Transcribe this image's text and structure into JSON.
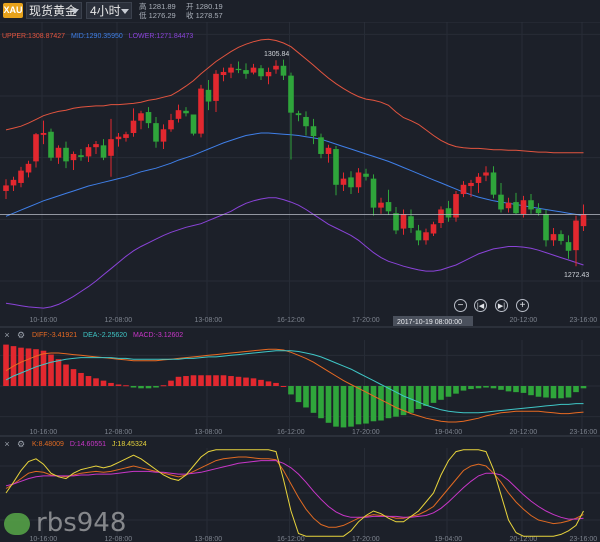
{
  "toolbar": {
    "badge": "XAU",
    "symbol": "现货黄金",
    "period": "4小时",
    "high_label": "高",
    "high": "1281.89",
    "low_label": "低",
    "low": "1276.29",
    "open_label": "开",
    "open": "1280.19",
    "close_label": "收",
    "close": "1278.57"
  },
  "legends": {
    "boll": {
      "upper": "UPPER:1308.87427",
      "mid": "MID:1290.35950",
      "lower": "LOWER:1271.84473"
    },
    "macd": {
      "diff": "DIFF:-3.41921",
      "dea": "DEA:-2.25620",
      "macd": "MACD:-3.12602"
    },
    "kdj": {
      "k": "K:8.48009",
      "d": "D:14.60551",
      "j": "J:18.45324"
    }
  },
  "controls": {
    "close_icon": "×",
    "settings_icon": "gear-icon"
  },
  "watermark": "rbs948",
  "colors": {
    "up": "#e2282f",
    "down": "#2fa53b",
    "upper": "#e2543f",
    "mid": "#3f7fe8",
    "lower": "#8a43d8",
    "diff": "#e86a22",
    "dea": "#3fc6c6",
    "k": "#e06a22",
    "d": "#c836c8",
    "j": "#e8d43c"
  },
  "chart_data": [
    {
      "type": "candlestick",
      "name": "main",
      "x_ticks": [
        "10-16:00",
        "12-08:00",
        "13-08:00",
        "16-12:00",
        "17-20:00",
        "19-04:00",
        "20-12:00",
        "23-16:00"
      ],
      "crosshair_label": "2017-10-19 08:00:00",
      "ylim": [
        1264,
        1312
      ],
      "annotations": [
        {
          "text": "1305.84",
          "index": 36,
          "value": 1305.84
        },
        {
          "text": "1272.43",
          "index": 76,
          "value": 1272.43
        }
      ],
      "candles": [
        [
          1284.6,
          1286.5,
          1283.3,
          1285.5
        ],
        [
          1285.5,
          1286.9,
          1284.6,
          1286.4
        ],
        [
          1285.9,
          1288.5,
          1285.2,
          1287.9
        ],
        [
          1287.6,
          1289.5,
          1286.8,
          1289.0
        ],
        [
          1289.4,
          1294.0,
          1288.4,
          1293.8
        ],
        [
          1293.7,
          1296.0,
          1292.2,
          1294.0
        ],
        [
          1294.2,
          1294.7,
          1289.5,
          1290.0
        ],
        [
          1290.0,
          1292.0,
          1289.0,
          1291.6
        ],
        [
          1291.6,
          1292.6,
          1288.3,
          1289.4
        ],
        [
          1289.6,
          1291.0,
          1288.0,
          1290.6
        ],
        [
          1290.4,
          1291.4,
          1289.5,
          1290.1
        ],
        [
          1290.2,
          1292.2,
          1289.3,
          1291.7
        ],
        [
          1291.7,
          1292.7,
          1290.6,
          1292.2
        ],
        [
          1292.0,
          1293.0,
          1289.6,
          1290.0
        ],
        [
          1290.3,
          1296.3,
          1286.9,
          1293.0
        ],
        [
          1293.0,
          1294.0,
          1291.8,
          1293.4
        ],
        [
          1293.2,
          1294.2,
          1292.6,
          1293.8
        ],
        [
          1294.0,
          1298.0,
          1293.4,
          1296.0
        ],
        [
          1296.0,
          1297.6,
          1294.6,
          1297.2
        ],
        [
          1297.4,
          1298.2,
          1294.8,
          1295.6
        ],
        [
          1295.6,
          1296.6,
          1291.6,
          1292.6
        ],
        [
          1292.6,
          1295.4,
          1291.4,
          1294.6
        ],
        [
          1294.6,
          1297.1,
          1294.2,
          1296.1
        ],
        [
          1296.3,
          1298.6,
          1295.7,
          1297.7
        ],
        [
          1297.6,
          1298.2,
          1296.7,
          1297.2
        ],
        [
          1297.0,
          1294.9,
          1293.6,
          1293.9
        ],
        [
          1293.9,
          1301.8,
          1293.3,
          1301.2
        ],
        [
          1301.0,
          1302.6,
          1297.7,
          1299.1
        ],
        [
          1299.2,
          1304.2,
          1297.4,
          1303.6
        ],
        [
          1303.4,
          1304.6,
          1302.4,
          1303.9
        ],
        [
          1303.8,
          1305.2,
          1302.9,
          1304.6
        ],
        [
          1304.4,
          1305.6,
          1303.7,
          1304.2
        ],
        [
          1304.2,
          1305.3,
          1302.8,
          1303.6
        ],
        [
          1303.8,
          1305.2,
          1303.5,
          1304.6
        ],
        [
          1304.5,
          1305.0,
          1302.6,
          1303.2
        ],
        [
          1303.2,
          1304.6,
          1301.9,
          1303.9
        ],
        [
          1304.3,
          1305.8,
          1303.6,
          1304.9
        ],
        [
          1304.9,
          1305.9,
          1302.6,
          1303.3
        ],
        [
          1303.3,
          1303.8,
          1289.7,
          1297.3
        ],
        [
          1297.2,
          1297.6,
          1295.9,
          1296.9
        ],
        [
          1296.6,
          1297.5,
          1293.6,
          1295.1
        ],
        [
          1295.1,
          1296.3,
          1292.2,
          1293.5
        ],
        [
          1293.3,
          1293.9,
          1289.9,
          1290.6
        ],
        [
          1290.6,
          1292.1,
          1289.2,
          1291.6
        ],
        [
          1291.4,
          1291.9,
          1283.9,
          1285.6
        ],
        [
          1285.6,
          1287.6,
          1284.6,
          1286.6
        ],
        [
          1286.8,
          1287.8,
          1284.1,
          1285.2
        ],
        [
          1285.2,
          1288.3,
          1284.3,
          1287.6
        ],
        [
          1287.4,
          1288.2,
          1286.3,
          1286.9
        ],
        [
          1286.6,
          1287.3,
          1280.6,
          1281.9
        ],
        [
          1281.9,
          1283.5,
          1280.9,
          1282.7
        ],
        [
          1282.8,
          1284.8,
          1280.7,
          1281.3
        ],
        [
          1281.0,
          1282.0,
          1277.6,
          1278.2
        ],
        [
          1278.5,
          1281.6,
          1277.5,
          1280.8
        ],
        [
          1280.5,
          1281.6,
          1277.8,
          1278.6
        ],
        [
          1278.2,
          1279.1,
          1275.8,
          1276.6
        ],
        [
          1276.6,
          1278.5,
          1275.9,
          1277.9
        ],
        [
          1277.7,
          1279.6,
          1277.3,
          1279.2
        ],
        [
          1279.4,
          1282.1,
          1278.6,
          1281.6
        ],
        [
          1281.8,
          1283.0,
          1279.6,
          1280.3
        ],
        [
          1280.3,
          1284.6,
          1279.6,
          1284.1
        ],
        [
          1284.1,
          1286.2,
          1283.6,
          1285.6
        ],
        [
          1285.4,
          1286.4,
          1283.6,
          1285.9
        ],
        [
          1285.9,
          1287.5,
          1284.3,
          1286.9
        ],
        [
          1287.1,
          1288.6,
          1286.2,
          1287.6
        ],
        [
          1287.6,
          1288.6,
          1283.4,
          1284.0
        ],
        [
          1284.0,
          1285.9,
          1281.1,
          1281.6
        ],
        [
          1281.8,
          1283.5,
          1281.1,
          1282.7
        ],
        [
          1282.8,
          1284.3,
          1280.8,
          1281.0
        ],
        [
          1280.8,
          1283.8,
          1280.3,
          1283.1
        ],
        [
          1283.1,
          1284.1,
          1280.9,
          1281.6
        ],
        [
          1281.7,
          1282.6,
          1280.6,
          1281.0
        ],
        [
          1280.8,
          1281.6,
          1275.6,
          1276.6
        ],
        [
          1276.6,
          1278.6,
          1275.7,
          1277.6
        ],
        [
          1277.6,
          1278.2,
          1275.9,
          1276.5
        ],
        [
          1276.3,
          1277.4,
          1273.6,
          1274.9
        ],
        [
          1275.0,
          1280.6,
          1272.4,
          1279.8
        ],
        [
          1278.9,
          1282.4,
          1278.1,
          1280.8
        ]
      ],
      "bands": {
        "upper": [
          1294.5,
          1294.8,
          1295.1,
          1295.6,
          1296.2,
          1296.8,
          1297.2,
          1297.5,
          1297.7,
          1298.0,
          1298.2,
          1298.3,
          1298.4,
          1298.4,
          1298.6,
          1298.6,
          1298.7,
          1298.8,
          1299.0,
          1299.3,
          1299.5,
          1299.8,
          1300.1,
          1300.8,
          1301.6,
          1302.5,
          1303.6,
          1304.6,
          1305.6,
          1306.4,
          1307.2,
          1307.9,
          1308.4,
          1308.8,
          1309.1,
          1309.2,
          1309.0,
          1308.6,
          1308.0,
          1307.0,
          1306.0,
          1305.0,
          1303.9,
          1302.9,
          1302.0,
          1301.2,
          1300.5,
          1299.9,
          1299.5,
          1299.3,
          1299.0,
          1298.5,
          1297.4,
          1296.5,
          1296.0,
          1295.4,
          1294.5,
          1293.6,
          1292.8,
          1292.2,
          1291.8,
          1291.6,
          1291.5,
          1291.5,
          1291.4,
          1291.3,
          1291.3,
          1291.2,
          1291.2,
          1291.1,
          1291.0,
          1290.9,
          1290.9,
          1290.8,
          1290.8,
          1290.8,
          1290.8,
          1290.8
        ],
        "mid": [
          1280.5,
          1281.0,
          1281.5,
          1282.0,
          1282.5,
          1283.0,
          1283.4,
          1283.8,
          1284.2,
          1284.6,
          1285.0,
          1285.4,
          1285.7,
          1286.0,
          1286.3,
          1286.6,
          1286.9,
          1287.3,
          1287.7,
          1288.0,
          1288.3,
          1288.7,
          1289.1,
          1289.6,
          1290.0,
          1290.4,
          1290.9,
          1291.4,
          1291.9,
          1292.4,
          1292.8,
          1293.2,
          1293.6,
          1293.8,
          1294.0,
          1294.0,
          1293.9,
          1293.8,
          1293.7,
          1293.6,
          1293.4,
          1293.2,
          1293.0,
          1292.6,
          1292.2,
          1291.8,
          1291.4,
          1291.0,
          1290.6,
          1290.2,
          1289.8,
          1289.4,
          1288.9,
          1288.4,
          1287.9,
          1287.4,
          1286.9,
          1286.4,
          1285.9,
          1285.4,
          1284.9,
          1284.4,
          1284.0,
          1283.6,
          1283.3,
          1283.0,
          1282.8,
          1282.6,
          1282.4,
          1282.2,
          1282.0,
          1281.8,
          1281.6,
          1281.4,
          1281.2,
          1281.0,
          1280.8,
          1280.6
        ],
        "lower": [
          1266.4,
          1266.2,
          1266.0,
          1265.8,
          1265.7,
          1265.6,
          1265.8,
          1266.2,
          1266.8,
          1267.5,
          1268.3,
          1269.1,
          1270.0,
          1271.0,
          1272.0,
          1273.0,
          1274.0,
          1274.9,
          1275.6,
          1276.2,
          1276.8,
          1277.4,
          1277.9,
          1278.3,
          1278.7,
          1279.0,
          1279.3,
          1279.8,
          1280.3,
          1280.8,
          1281.3,
          1282.0,
          1282.6,
          1283.0,
          1283.3,
          1283.5,
          1283.5,
          1283.2,
          1282.8,
          1282.3,
          1281.6,
          1280.8,
          1280.0,
          1279.2,
          1278.6,
          1278.0,
          1277.4,
          1276.6,
          1275.6,
          1274.6,
          1273.8,
          1273.2,
          1272.8,
          1272.4,
          1272.1,
          1271.8,
          1271.6,
          1271.6,
          1271.8,
          1272.2,
          1272.6,
          1273.2,
          1273.8,
          1274.4,
          1274.8,
          1275.2,
          1275.4,
          1275.6,
          1275.6,
          1275.5,
          1275.3,
          1275.0,
          1274.6,
          1274.2,
          1273.8,
          1273.4,
          1273.0,
          1272.6
        ]
      }
    },
    {
      "type": "macd",
      "name": "MACD",
      "ylim": [
        -6,
        6
      ],
      "diff": [
        2.0,
        2.6,
        3.1,
        3.5,
        3.9,
        4.2,
        4.3,
        4.3,
        4.2,
        4.1,
        4.0,
        3.9,
        3.8,
        3.7,
        3.6,
        3.5,
        3.4,
        3.3,
        3.3,
        3.3,
        3.3,
        3.4,
        3.5,
        3.6,
        3.7,
        3.8,
        3.9,
        4.0,
        4.1,
        4.2,
        4.3,
        4.4,
        4.5,
        4.6,
        4.7,
        4.8,
        4.8,
        4.7,
        4.4,
        4.0,
        3.6,
        3.1,
        2.5,
        1.9,
        1.3,
        0.7,
        0.2,
        -0.3,
        -0.8,
        -1.3,
        -1.8,
        -2.3,
        -2.8,
        -3.2,
        -3.6,
        -3.9,
        -4.2,
        -4.4,
        -4.6,
        -4.7,
        -4.7,
        -4.6,
        -4.4,
        -4.2,
        -3.9,
        -3.7,
        -3.5,
        -3.4,
        -3.3,
        -3.3,
        -3.3,
        -3.3,
        -3.4,
        -3.5,
        -3.6,
        -3.6,
        -3.5,
        -3.4
      ],
      "dea": [
        0.8,
        1.3,
        1.7,
        2.1,
        2.5,
        2.8,
        3.1,
        3.3,
        3.5,
        3.6,
        3.7,
        3.7,
        3.7,
        3.7,
        3.7,
        3.6,
        3.6,
        3.5,
        3.5,
        3.5,
        3.5,
        3.5,
        3.5,
        3.5,
        3.6,
        3.6,
        3.7,
        3.8,
        3.8,
        3.9,
        4.0,
        4.1,
        4.2,
        4.3,
        4.4,
        4.5,
        4.6,
        4.6,
        4.6,
        4.5,
        4.3,
        4.1,
        3.8,
        3.4,
        3.0,
        2.6,
        2.2,
        1.7,
        1.2,
        0.7,
        0.2,
        -0.3,
        -0.8,
        -1.3,
        -1.7,
        -2.1,
        -2.5,
        -2.8,
        -3.1,
        -3.3,
        -3.4,
        -3.5,
        -3.5,
        -3.5,
        -3.4,
        -3.3,
        -3.2,
        -3.1,
        -3.0,
        -2.9,
        -2.8,
        -2.7,
        -2.6,
        -2.5,
        -2.4,
        -2.4,
        -2.3,
        -2.3
      ],
      "histogram": [
        5.4,
        5.2,
        5.0,
        4.9,
        4.8,
        4.6,
        4.1,
        3.5,
        2.8,
        2.2,
        1.7,
        1.3,
        1.0,
        0.7,
        0.4,
        0.2,
        0.1,
        -0.2,
        -0.3,
        -0.3,
        -0.2,
        0.1,
        0.7,
        1.2,
        1.3,
        1.4,
        1.4,
        1.4,
        1.4,
        1.4,
        1.3,
        1.2,
        1.1,
        1.0,
        0.8,
        0.6,
        0.4,
        0.0,
        -1.1,
        -2.1,
        -2.8,
        -3.5,
        -4.2,
        -4.8,
        -5.3,
        -5.4,
        -5.3,
        -5.0,
        -4.9,
        -4.6,
        -4.5,
        -4.2,
        -4.0,
        -3.8,
        -3.5,
        -3.0,
        -2.6,
        -2.2,
        -1.8,
        -1.4,
        -1.0,
        -0.6,
        -0.4,
        -0.3,
        -0.2,
        -0.3,
        -0.5,
        -0.7,
        -0.8,
        -0.9,
        -1.2,
        -1.4,
        -1.5,
        -1.6,
        -1.6,
        -1.5,
        -0.8,
        -0.3
      ]
    },
    {
      "type": "kdj",
      "name": "KDJ",
      "ylim": [
        0,
        100
      ],
      "k": [
        55,
        60,
        66,
        72,
        74,
        73,
        70,
        69,
        68,
        70,
        72,
        73,
        74,
        73,
        74,
        76,
        78,
        80,
        78,
        76,
        74,
        72,
        70,
        68,
        70,
        74,
        78,
        82,
        86,
        88,
        89,
        90,
        90,
        89,
        88,
        88,
        87,
        75,
        60,
        45,
        32,
        22,
        15,
        12,
        12,
        14,
        18,
        22,
        24,
        26,
        25,
        24,
        22,
        22,
        24,
        26,
        30,
        35,
        45,
        55,
        65,
        75,
        80,
        82,
        80,
        72,
        62,
        50,
        40,
        32,
        25,
        20,
        18,
        16,
        17,
        19,
        22,
        26
      ],
      "d": [
        58,
        60,
        63,
        66,
        68,
        69,
        69,
        69,
        69,
        69,
        70,
        70,
        71,
        71,
        71,
        72,
        73,
        74,
        74,
        74,
        73,
        73,
        72,
        71,
        71,
        72,
        73,
        75,
        77,
        79,
        81,
        83,
        84,
        85,
        86,
        86,
        86,
        83,
        78,
        71,
        62,
        52,
        43,
        35,
        29,
        25,
        23,
        23,
        23,
        24,
        24,
        24,
        24,
        23,
        23,
        24,
        25,
        28,
        33,
        40,
        48,
        56,
        63,
        69,
        72,
        72,
        70,
        64,
        56,
        48,
        41,
        35,
        30,
        26,
        23,
        21,
        21,
        22
      ],
      "j": [
        50,
        62,
        75,
        85,
        88,
        82,
        72,
        68,
        66,
        72,
        76,
        78,
        80,
        78,
        80,
        84,
        88,
        92,
        88,
        82,
        76,
        70,
        66,
        64,
        70,
        80,
        90,
        96,
        98,
        98,
        98,
        98,
        98,
        98,
        98,
        98,
        96,
        65,
        30,
        5,
        2,
        2,
        2,
        2,
        2,
        2,
        8,
        18,
        25,
        30,
        27,
        22,
        18,
        18,
        24,
        30,
        40,
        50,
        70,
        86,
        96,
        98,
        98,
        98,
        96,
        76,
        48,
        20,
        6,
        2,
        2,
        2,
        2,
        2,
        4,
        8,
        14,
        30
      ]
    }
  ]
}
